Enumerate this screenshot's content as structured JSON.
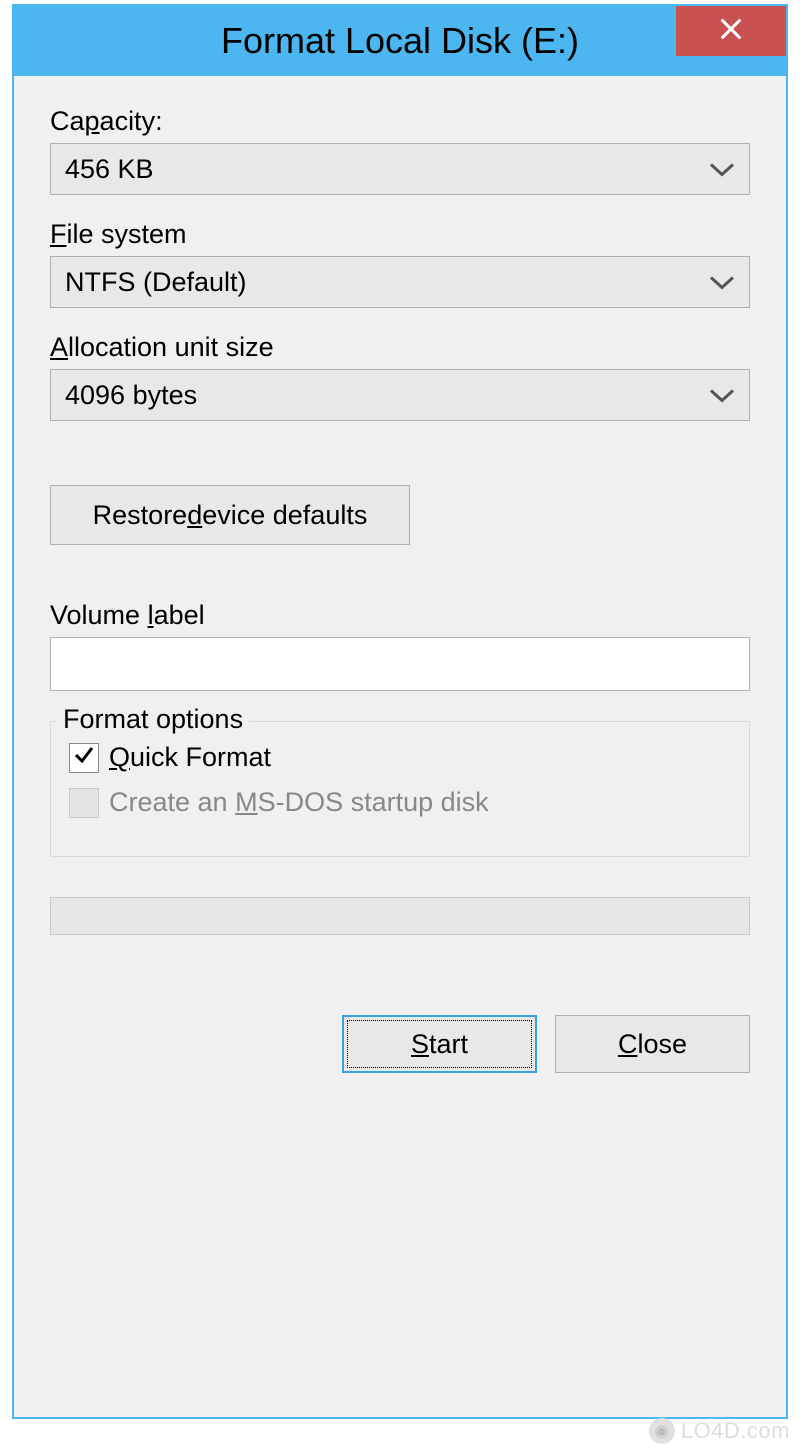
{
  "window": {
    "title": "Format Local Disk (E:)"
  },
  "capacity": {
    "label_pre": "Ca",
    "label_accel": "p",
    "label_post": "acity:",
    "value": "456 KB"
  },
  "filesystem": {
    "label_accel": "F",
    "label_post": "ile system",
    "value": "NTFS (Default)"
  },
  "allocation": {
    "label_accel": "A",
    "label_post": "llocation unit size",
    "value": "4096 bytes"
  },
  "restore": {
    "label_pre": "Restore ",
    "label_accel": "d",
    "label_post": "evice defaults"
  },
  "volume": {
    "label_pre": "Volume ",
    "label_accel": "l",
    "label_post": "abel",
    "value": ""
  },
  "format_options": {
    "legend": "Format options",
    "quick": {
      "checked": true,
      "label_accel": "Q",
      "label_post": "uick Format"
    },
    "msdos": {
      "checked": false,
      "disabled": true,
      "label_pre": "Create an ",
      "label_accel": "M",
      "label_post": "S-DOS startup disk"
    }
  },
  "buttons": {
    "start_accel": "S",
    "start_post": "tart",
    "close_accel": "C",
    "close_post": "lose"
  },
  "watermark": "LO4D.com"
}
